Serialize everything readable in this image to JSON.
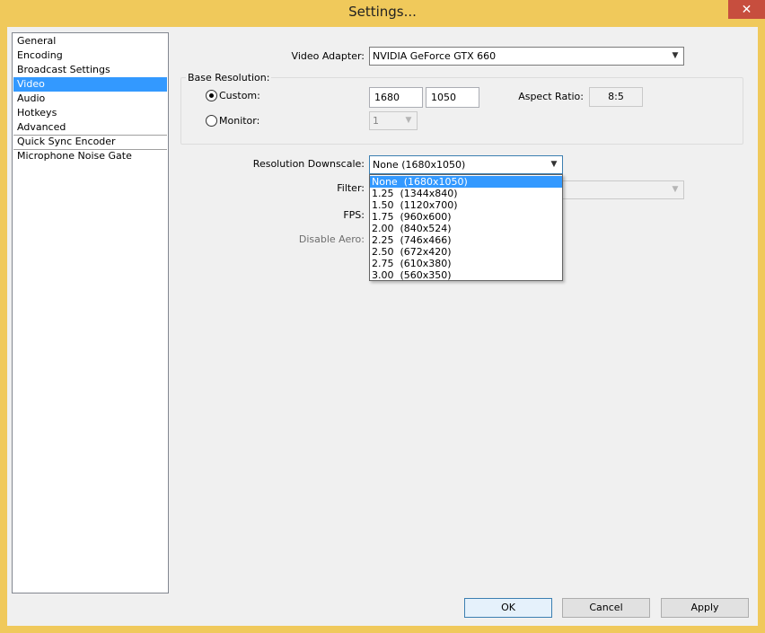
{
  "window": {
    "title": "Settings...",
    "close_glyph": "✕"
  },
  "sidebar": {
    "items": [
      {
        "label": "General"
      },
      {
        "label": "Encoding"
      },
      {
        "label": "Broadcast Settings"
      },
      {
        "label": "Video",
        "selected": true
      },
      {
        "label": "Audio"
      },
      {
        "label": "Hotkeys"
      },
      {
        "label": "Advanced"
      },
      {
        "label": "Quick Sync Encoder"
      },
      {
        "label": "Microphone Noise Gate"
      }
    ]
  },
  "video": {
    "adapter_label": "Video Adapter:",
    "adapter_value": "NVIDIA GeForce GTX 660",
    "base_resolution_label": "Base Resolution:",
    "custom_label": "Custom:",
    "custom_width": "1680",
    "custom_height": "1050",
    "aspect_ratio_label": "Aspect Ratio:",
    "aspect_ratio_value": "8:5",
    "monitor_label": "Monitor:",
    "monitor_value": "1",
    "downscale_label": "Resolution Downscale:",
    "downscale_value": "None  (1680x1050)",
    "filter_label": "Filter:",
    "fps_label": "FPS:",
    "disable_aero_label": "Disable Aero:"
  },
  "downscale_options": [
    "None  (1680x1050)",
    "1.25  (1344x840)",
    "1.50  (1120x700)",
    "1.75  (960x600)",
    "2.00  (840x524)",
    "2.25  (746x466)",
    "2.50  (672x420)",
    "2.75  (610x380)",
    "3.00  (560x350)"
  ],
  "buttons": {
    "ok": "OK",
    "cancel": "Cancel",
    "apply": "Apply"
  },
  "icons": {
    "dropdown_arrow": "chevron-down-icon",
    "arrow_glyph": "▼"
  },
  "colors": {
    "title_bar": "#f0c95b",
    "selection": "#3399ff",
    "close": "#c74e3e"
  }
}
